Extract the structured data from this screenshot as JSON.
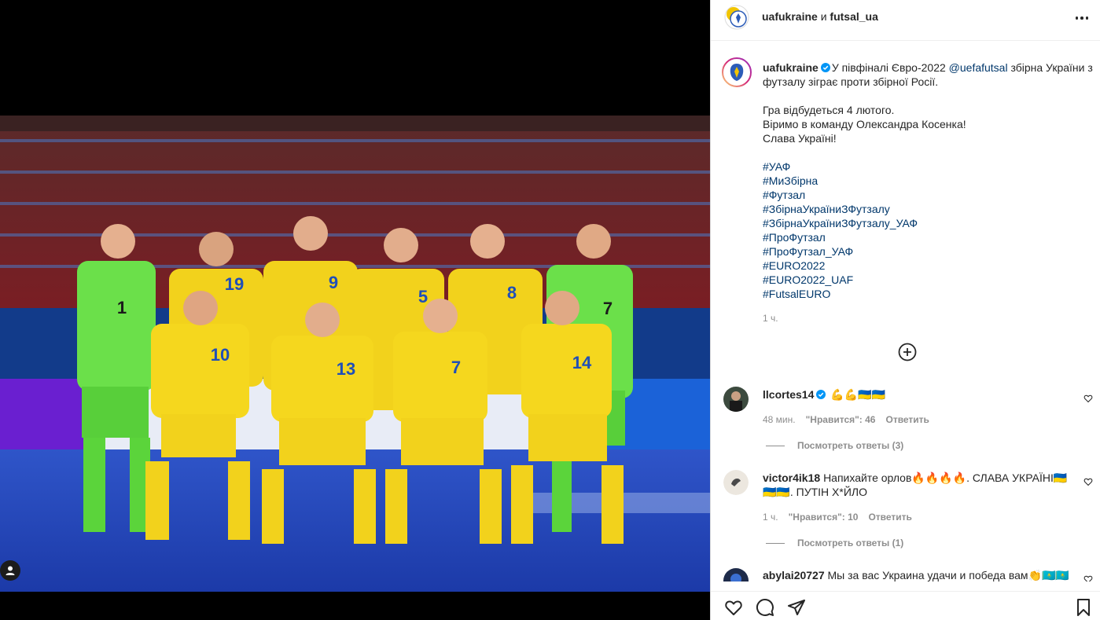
{
  "header": {
    "user1": "uafukraine",
    "conjunction": "и",
    "user2": "futsal_ua",
    "more_icon": "more-horizontal-icon"
  },
  "caption": {
    "username": "uafukraine",
    "line1_before": "У півфіналі Євро-2022 ",
    "mention": "@uefafutsal",
    "line1_after": " збірна України з футзалу зіграє проти збірної Росії.",
    "paragraph2": [
      "Гра відбудеться 4 лютого.",
      "Віримо в команду Олександра Косенка!",
      "Слава Україні!"
    ],
    "hashtags": [
      "#УАФ",
      "#МиЗбірна",
      "#Футзал",
      "#ЗбірнаУкраїниЗФутзалу",
      "#ЗбірнаУкраїниЗФутзалу_УАФ",
      "#ПроФутзал",
      "#ПроФутзал_УАФ",
      "#EURO2022",
      "#EURO2022_UAF",
      "#FutsalEURO"
    ],
    "time": "1 ч."
  },
  "comments": [
    {
      "username": "llcortes14",
      "verified": true,
      "text": "💪💪🇺🇦🇺🇦",
      "time": "48 мин.",
      "likes": "\"Нравится\": 46",
      "reply": "Ответить",
      "view_replies": "Посмотреть ответы (3)"
    },
    {
      "username": "victor4ik18",
      "verified": false,
      "text": "Напихайте орлов🔥🔥🔥🔥. СЛАВА УКРАЇНІ🇺🇦🇺🇦🇺🇦. ПУТІН Х*ЙЛО",
      "time": "1 ч.",
      "likes": "\"Нравится\": 10",
      "reply": "Ответить",
      "view_replies": "Посмотреть ответы (1)"
    },
    {
      "username": "abylai20727",
      "verified": false,
      "text": "Мы за вас Украина удачи и победа вам👏🇰🇿🇰🇿🇰🇿"
    }
  ],
  "media": {
    "jerseys": [
      "1",
      "19",
      "9",
      "5",
      "8",
      "7",
      "10",
      "13",
      "7",
      "14"
    ]
  },
  "colors": {
    "link": "#00376b",
    "muted": "#8e8e8e",
    "verified": "#0095f6",
    "jersey_yellow": "#f2d21c",
    "keeper_green": "#6be04a"
  }
}
